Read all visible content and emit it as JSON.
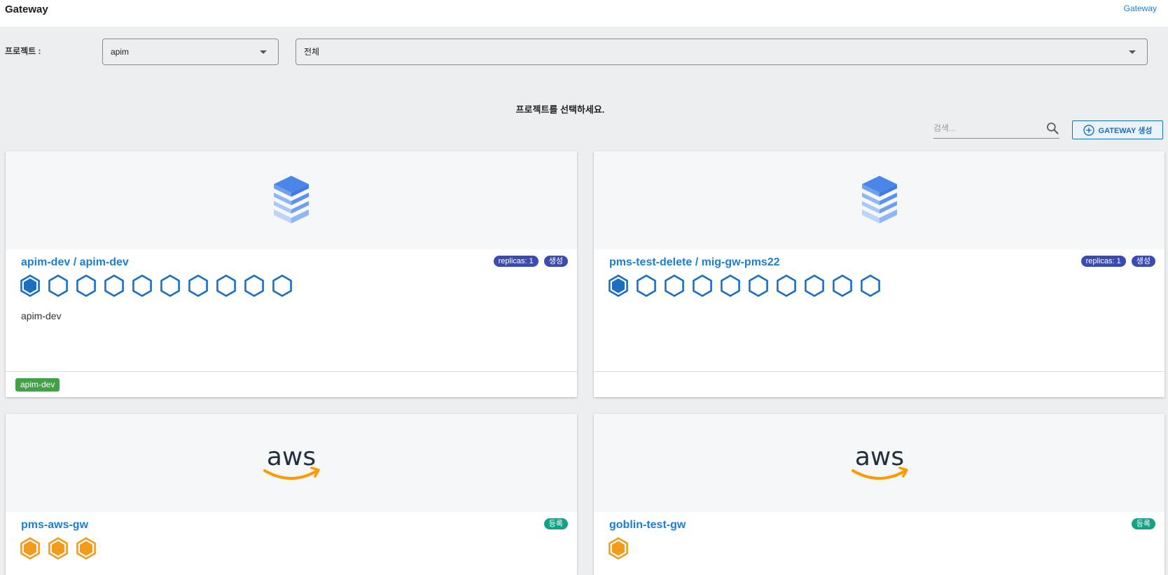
{
  "header": {
    "title": "Gateway",
    "breadcrumb": "Gateway"
  },
  "filters": {
    "project_label": "프로젝트 :",
    "project_value": "apim",
    "scope_value": "전체"
  },
  "hint": "프로젝트를 선택하세요.",
  "search": {
    "placeholder": "검색..."
  },
  "create_button": {
    "label": "GATEWAY 생성"
  },
  "colors": {
    "accent": "#1a7fd4",
    "hex_blue": "#1a6fc0",
    "hex_orange": "#f29b1d",
    "badge_blue": "#3b4cb0",
    "badge_teal": "#16a085",
    "tag_green": "#43a047"
  },
  "cards": [
    {
      "title_ns": "apim-dev / ",
      "title_name": "apim-dev",
      "replicas": "replicas: 1",
      "status": "생성",
      "nodes_total": 10,
      "nodes_active": 1,
      "description": "apim-dev",
      "tag": "apim-dev",
      "logo": "stack-icon"
    },
    {
      "title_ns": "pms-test-delete / ",
      "title_name": "mig-gw-pms22",
      "replicas": "replicas: 1",
      "status": "생성",
      "nodes_total": 10,
      "nodes_active": 1,
      "description": "",
      "tag": "",
      "logo": "stack-icon"
    },
    {
      "title_name": "pms-aws-gw",
      "status": "등록",
      "nodes_total": 3,
      "logo": "aws-logo"
    },
    {
      "title_name": "goblin-test-gw",
      "status": "등록",
      "nodes_total": 1,
      "logo": "aws-logo"
    }
  ]
}
